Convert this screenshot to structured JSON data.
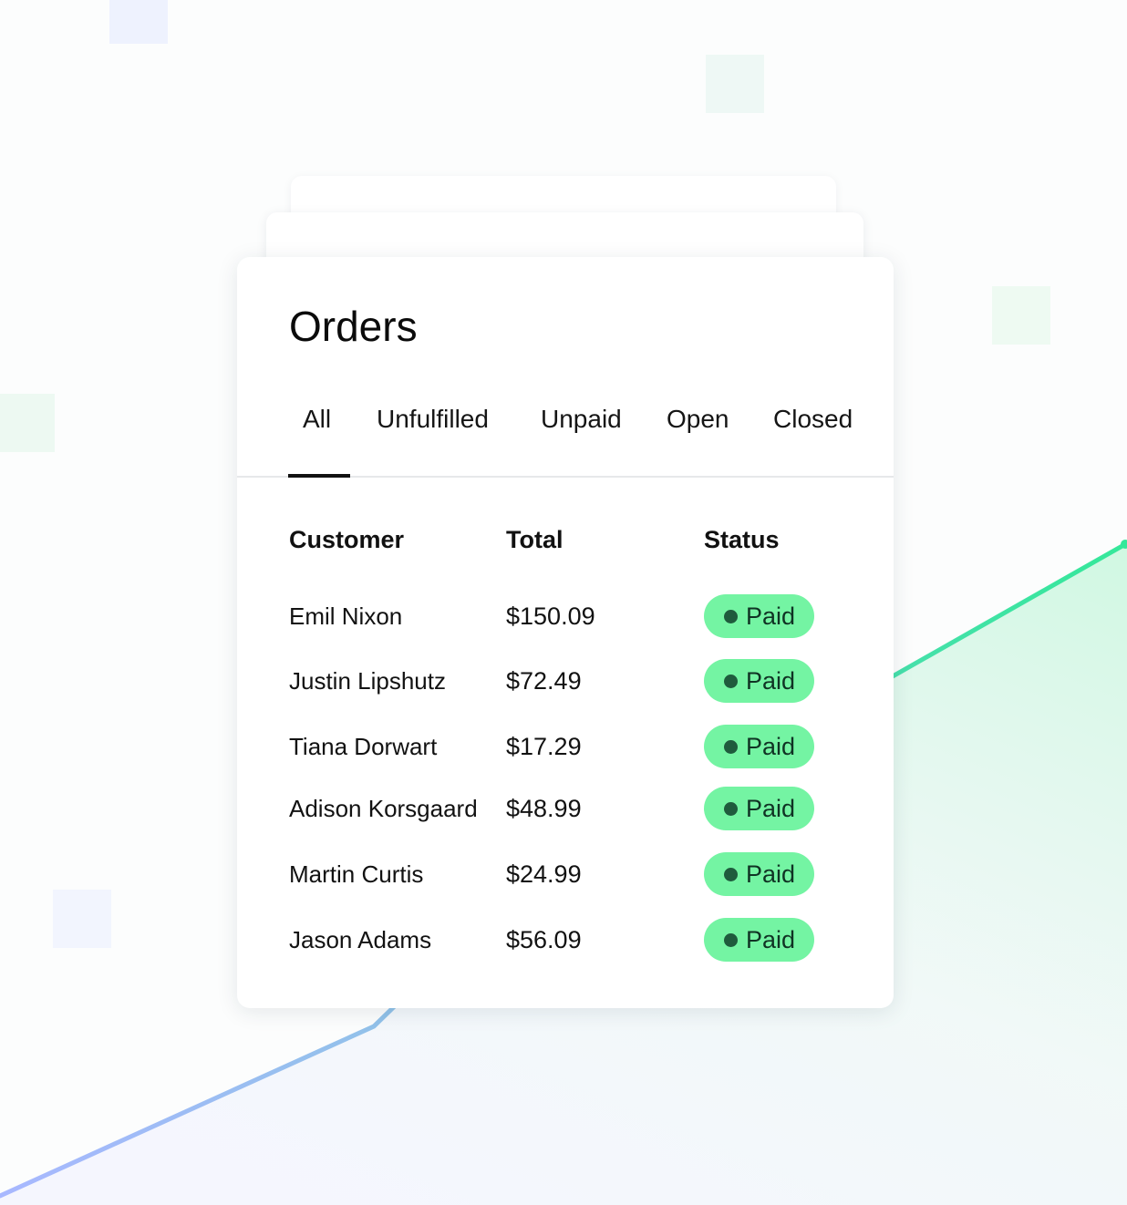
{
  "orders": {
    "title": "Orders",
    "tabs": [
      {
        "label": "All",
        "active": true
      },
      {
        "label": "Unfulfilled",
        "active": false
      },
      {
        "label": "Unpaid",
        "active": false
      },
      {
        "label": "Open",
        "active": false
      },
      {
        "label": "Closed",
        "active": false
      }
    ],
    "columns": {
      "customer": "Customer",
      "total": "Total",
      "status": "Status"
    },
    "rows": [
      {
        "customer": "Emil Nixon",
        "total": "$150.09",
        "status": "Paid"
      },
      {
        "customer": "Justin Lipshutz",
        "total": "$72.49",
        "status": "Paid"
      },
      {
        "customer": "Tiana Dorwart",
        "total": "$17.29",
        "status": "Paid"
      },
      {
        "customer": "Adison Korsgaard",
        "total": "$48.99",
        "status": "Paid"
      },
      {
        "customer": "Martin Curtis",
        "total": "$24.99",
        "status": "Paid"
      },
      {
        "customer": "Jason Adams",
        "total": "$56.09",
        "status": "Paid"
      }
    ]
  },
  "colors": {
    "status_paid_bg": "#74f4a3",
    "status_paid_dot": "#1f5b3d",
    "accent_line_green": "#3ee8a0",
    "accent_line_blue": "#a8b8ff"
  }
}
